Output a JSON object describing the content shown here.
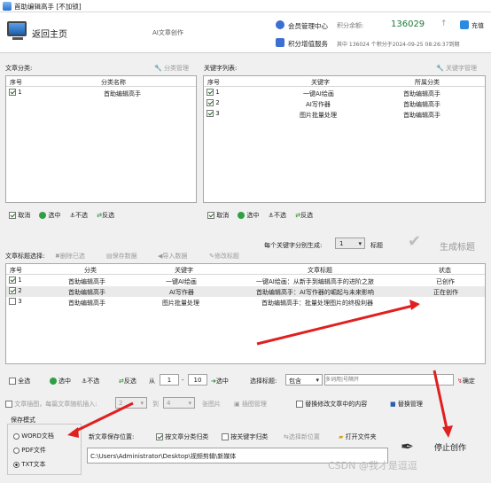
{
  "window": {
    "title": "首助编辑高手 [不加锁]"
  },
  "header": {
    "back_label": "返回主页",
    "module_label": "AI文章创作",
    "member_center": "会员管理中心",
    "points_label": "积分余额:",
    "points_value": "136029",
    "recharge": "充值",
    "points_service": "积分增值服务",
    "expiry_text": "其中 136024 个积分于2024-09-25 08:26:37到期"
  },
  "left_panel": {
    "title": "文章分类:",
    "manage": "分类管理",
    "col_index": "序号",
    "col_name": "分类名称",
    "rows": [
      {
        "index": "1",
        "name": "首助编辑高手"
      }
    ],
    "cancel": "取消",
    "select": "选中",
    "unselect": "不选",
    "invert": "反选"
  },
  "right_panel": {
    "title": "关键字列表:",
    "manage": "关键字管理",
    "col_index": "序号",
    "col_keyword": "关键字",
    "col_category": "所属分类",
    "rows": [
      {
        "index": "1",
        "keyword": "一键AI绘画",
        "category": "首助编辑高手"
      },
      {
        "index": "2",
        "keyword": "AI写作器",
        "category": "首助编辑高手"
      },
      {
        "index": "3",
        "keyword": "图片批量处理",
        "category": "首助编辑高手"
      }
    ],
    "cancel": "取消",
    "select": "选中",
    "unselect": "不选",
    "invert": "反选"
  },
  "generate": {
    "per_keyword_label": "每个关键字分别生成:",
    "count": "1",
    "unit": "标题",
    "button": "生成标题"
  },
  "titles": {
    "label": "文章标题选择:",
    "delete": "删除已选",
    "save": "保存数据",
    "import": "导入数据",
    "edit": "修改标题",
    "col_index": "序号",
    "col_category": "分类",
    "col_keyword": "关键字",
    "col_title": "文章标题",
    "col_status": "状态",
    "rows": [
      {
        "index": "1",
        "category": "首助编辑高手",
        "keyword": "一键AI绘画",
        "title": "一键AI绘画：从新手到编辑高手的进阶之旅",
        "status": "已创作"
      },
      {
        "index": "2",
        "category": "首助编辑高手",
        "keyword": "AI写作器",
        "title": "首助编辑高手：AI写作器的崛起与未来影响",
        "status": "正在创作"
      },
      {
        "index": "3",
        "category": "首助编辑高手",
        "keyword": "图片批量处理",
        "title": "首助编辑高手：批量处理图片的终极利器",
        "status": ""
      }
    ]
  },
  "select_bar": {
    "all": "全选",
    "select": "选中",
    "unselect": "不选",
    "invert": "反选",
    "from": "从",
    "from_value": "1",
    "dash": "-",
    "to_value": "10",
    "select_btn": "选中",
    "choose_title": "选择标题:",
    "match": "包含",
    "search_placeholder": "多词用|号隔开",
    "confirm": "确定"
  },
  "insert_bar": {
    "insert_label": "文章插图，每篇文章随机插入:",
    "insert_from": "2",
    "to": "到",
    "insert_to": "4",
    "images_unit": "张图片",
    "image_manage": "插图管理",
    "replace_label": "替换修改文章中的内容",
    "replace_manage": "替换管理"
  },
  "save_mode": {
    "title": "保存模式",
    "options": [
      "WORD文档",
      "PDF文件",
      "TXT文本"
    ],
    "selected": "TXT文本"
  },
  "save_location": {
    "label": "新文章保存位置:",
    "by_category": "按文章分类归类",
    "by_keyword": "按关键字归类",
    "choose": "选择新位置",
    "open_folder": "打开文件夹",
    "path": "C:\\Users\\Administrator\\Desktop\\视频剪辑\\新媒体"
  },
  "stop": {
    "label": "停止创作"
  },
  "watermark": "CSDN @我才是逗逗"
}
